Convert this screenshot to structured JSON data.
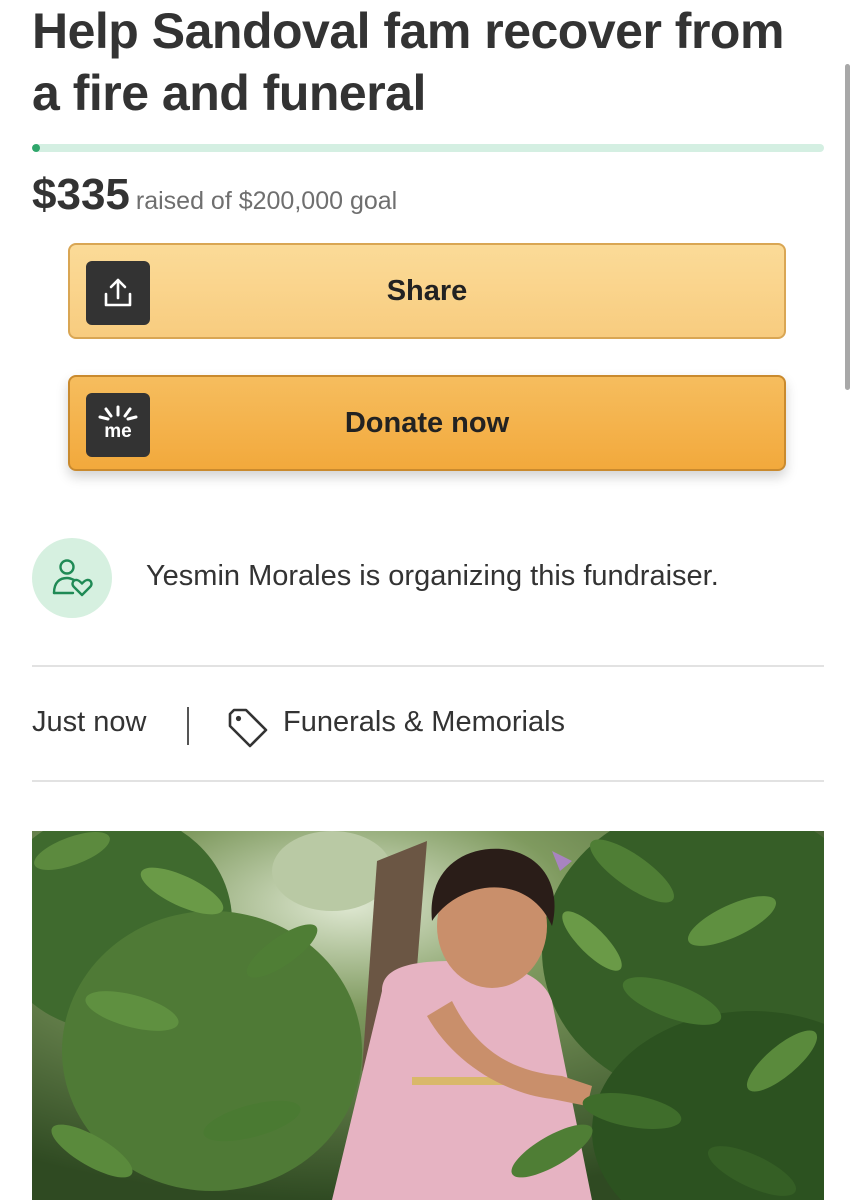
{
  "fundraiser": {
    "title": "Help Sandoval fam recover from a fire and funeral",
    "amount_raised": "$335",
    "raised_text": "raised of $200,000 goal",
    "progress_fraction": 0.001675
  },
  "actions": {
    "share_label": "Share",
    "donate_label": "Donate now",
    "donate_logo_text": "me"
  },
  "organizer": {
    "text": "Yesmin Morales is organizing this fundraiser."
  },
  "meta": {
    "time": "Just now",
    "category": "Funerals & Memorials"
  },
  "colors": {
    "progress": "#2fa66b",
    "progress_track": "#d4efe2",
    "share_button": "#f8cc7f",
    "donate_button": "#f2a93c",
    "avatar_bg": "#d6f0e0"
  },
  "icons": {
    "share": "share-upload-icon",
    "donate": "gofundme-logo-icon",
    "organizer": "person-heart-icon",
    "category": "tag-icon"
  }
}
